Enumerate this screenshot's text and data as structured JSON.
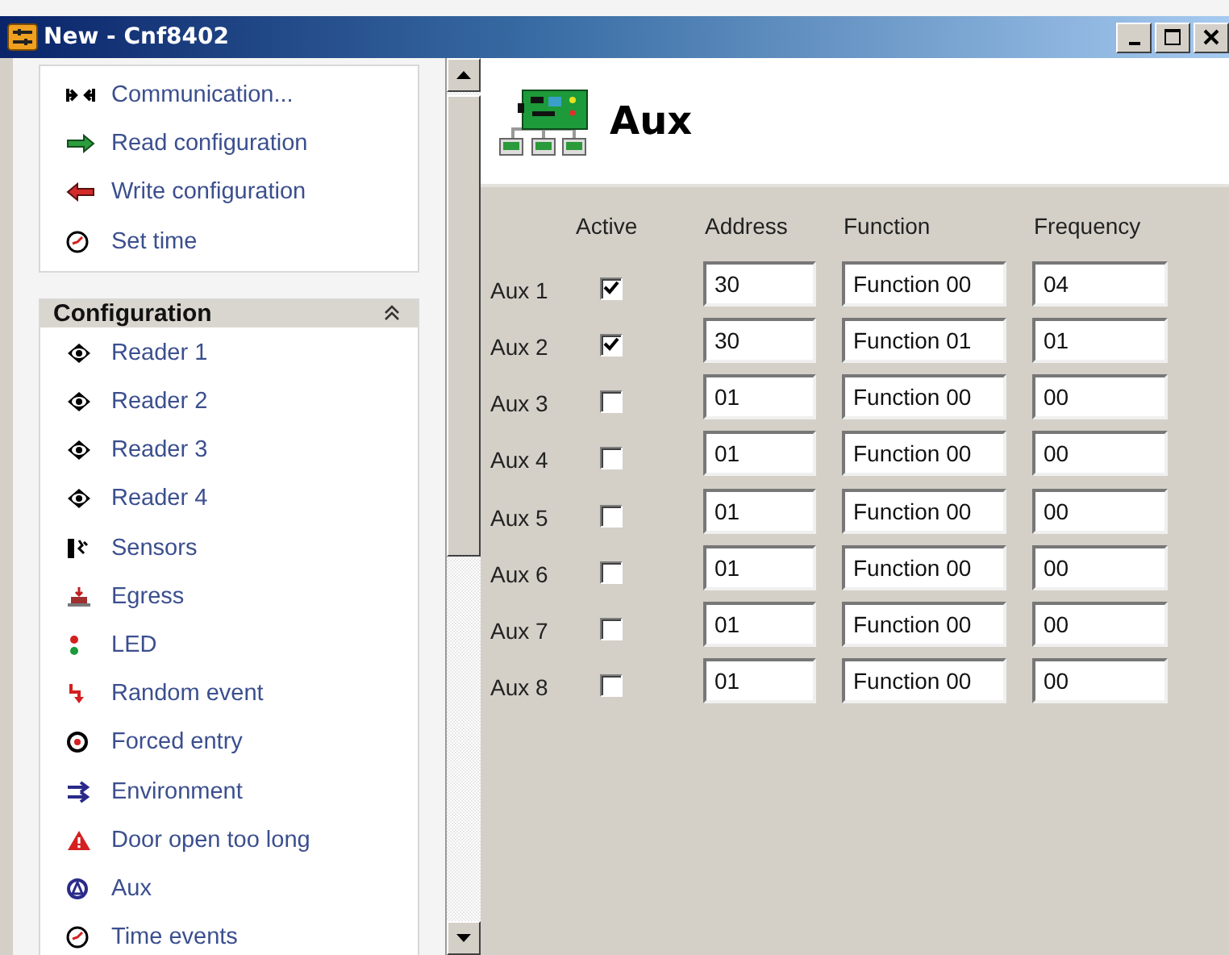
{
  "window": {
    "title": "New - Cnf8402"
  },
  "tasks": [
    {
      "label": "Communication...",
      "kind": "plug"
    },
    {
      "label": "Read configuration",
      "kind": "arrow-right"
    },
    {
      "label": "Write configuration",
      "kind": "arrow-left"
    },
    {
      "label": "Set time",
      "kind": "clock"
    }
  ],
  "configuration": {
    "title": "Configuration",
    "expanded": true,
    "items": [
      {
        "label": "Reader 1",
        "kind": "eye"
      },
      {
        "label": "Reader 2",
        "kind": "eye"
      },
      {
        "label": "Reader 3",
        "kind": "eye"
      },
      {
        "label": "Reader 4",
        "kind": "eye"
      },
      {
        "label": "Sensors",
        "kind": "sensor"
      },
      {
        "label": "Egress",
        "kind": "egress"
      },
      {
        "label": "LED",
        "kind": "led"
      },
      {
        "label": "Random event",
        "kind": "bolt"
      },
      {
        "label": "Forced entry",
        "kind": "target"
      },
      {
        "label": "Environment",
        "kind": "arrows"
      },
      {
        "label": "Door open too long",
        "kind": "warning"
      },
      {
        "label": "Aux",
        "kind": "aux"
      },
      {
        "label": "Time events",
        "kind": "clock"
      }
    ]
  },
  "page": {
    "title": "Aux",
    "columns": [
      "Active",
      "Address",
      "Function",
      "Frequency"
    ],
    "rows": [
      {
        "label": "Aux 1",
        "active": true,
        "address": "30",
        "function": "Function 00",
        "frequency": "04"
      },
      {
        "label": "Aux 2",
        "active": true,
        "address": "30",
        "function": "Function 01",
        "frequency": "01"
      },
      {
        "label": "Aux 3",
        "active": false,
        "address": "01",
        "function": "Function 00",
        "frequency": "00"
      },
      {
        "label": "Aux 4",
        "active": false,
        "address": "01",
        "function": "Function 00",
        "frequency": "00"
      },
      {
        "label": "Aux 5",
        "active": false,
        "address": "01",
        "function": "Function 00",
        "frequency": "00"
      },
      {
        "label": "Aux 6",
        "active": false,
        "address": "01",
        "function": "Function 00",
        "frequency": "00"
      },
      {
        "label": "Aux 7",
        "active": false,
        "address": "01",
        "function": "Function 00",
        "frequency": "00"
      },
      {
        "label": "Aux 8",
        "active": false,
        "address": "01",
        "function": "Function 00",
        "frequency": "00"
      }
    ]
  }
}
